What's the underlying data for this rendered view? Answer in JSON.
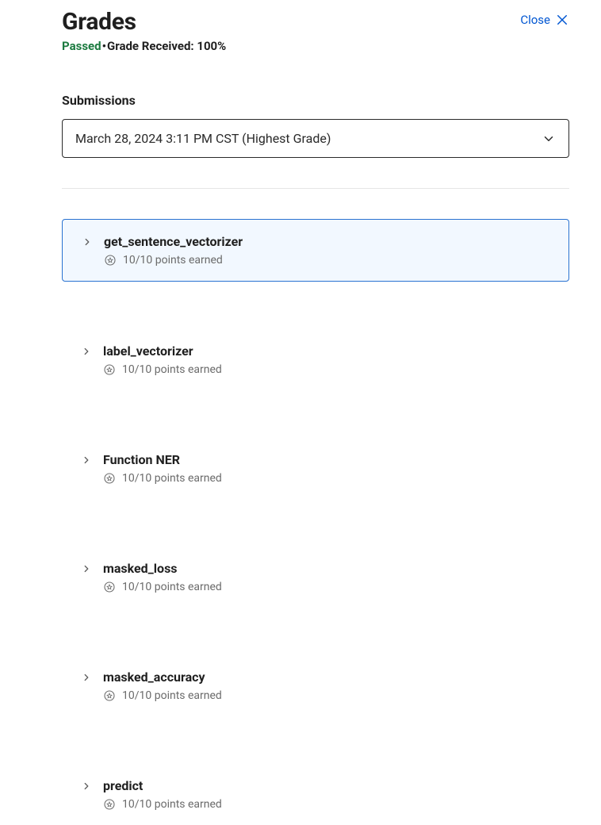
{
  "header": {
    "title": "Grades",
    "close_label": "Close"
  },
  "status": {
    "passed_label": "Passed",
    "grade_label": "Grade Received: 100%"
  },
  "submissions": {
    "label": "Submissions",
    "selected": "March 28, 2024 3:11 PM CST (Highest Grade)"
  },
  "items": [
    {
      "title": "get_sentence_vectorizer",
      "points": "10/10 points earned",
      "selected": true
    },
    {
      "title": "label_vectorizer",
      "points": "10/10 points earned",
      "selected": false
    },
    {
      "title": "Function NER",
      "points": "10/10 points earned",
      "selected": false
    },
    {
      "title": "masked_loss",
      "points": "10/10 points earned",
      "selected": false
    },
    {
      "title": "masked_accuracy",
      "points": "10/10 points earned",
      "selected": false
    },
    {
      "title": "predict",
      "points": "10/10 points earned",
      "selected": false
    }
  ]
}
